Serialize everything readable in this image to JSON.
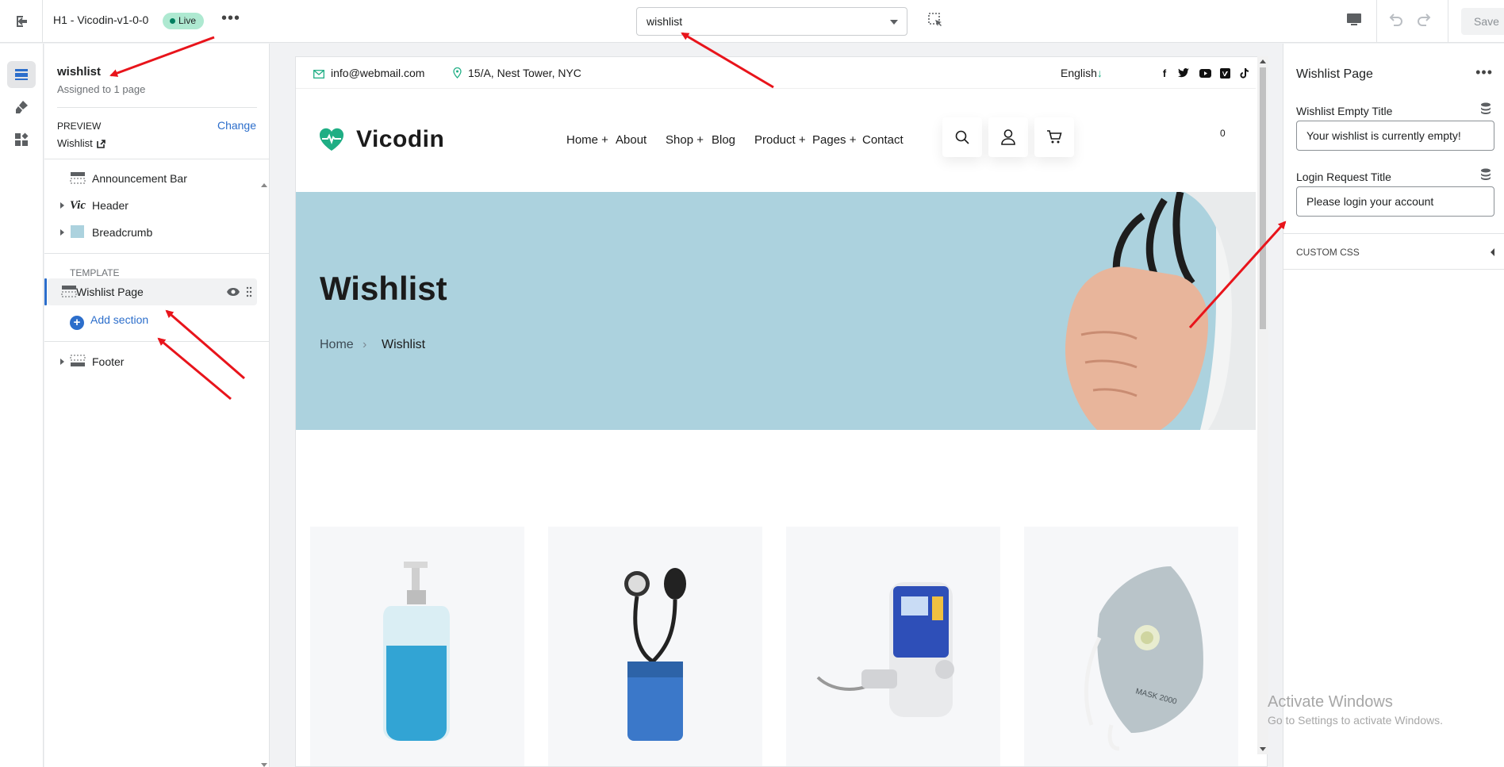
{
  "topbar": {
    "theme_name": "H1 - Vicodin-v1-0-0",
    "status": "Live",
    "more": "•••",
    "page_select": "wishlist",
    "save_label": "Save"
  },
  "sidebar": {
    "title": "wishlist",
    "subtitle": "Assigned to 1 page",
    "preview_label": "PREVIEW",
    "preview_change": "Change",
    "preview_page": "Wishlist",
    "sections": [
      {
        "label": "Announcement Bar"
      },
      {
        "label": "Header"
      },
      {
        "label": "Breadcrumb"
      }
    ],
    "template_label": "TEMPLATE",
    "template_item": "Wishlist Page",
    "add_section": "Add section",
    "footer": "Footer"
  },
  "store": {
    "email": "info@webmail.com",
    "address": "15/A, Nest Tower, NYC",
    "language": "English",
    "logo": "Vicodin",
    "nav": [
      "Home +",
      "About",
      "Shop +",
      "Blog",
      "Product +",
      "Pages +",
      "Contact"
    ],
    "cart_count": "0",
    "banner_title": "Wishlist",
    "crumb_home": "Home",
    "crumb_sep": "›",
    "crumb_current": "Wishlist",
    "accent_color": "#1fae84",
    "banner_color": "#acd2de"
  },
  "right_panel": {
    "title": "Wishlist Page",
    "field1_label": "Wishlist Empty Title",
    "field1_value": "Your wishlist is currently empty!",
    "field2_label": "Login Request Title",
    "field2_value": "Please login your account",
    "custom_css": "CUSTOM CSS"
  },
  "watermark": {
    "line1": "Activate Windows",
    "line2": "Go to Settings to activate Windows."
  }
}
